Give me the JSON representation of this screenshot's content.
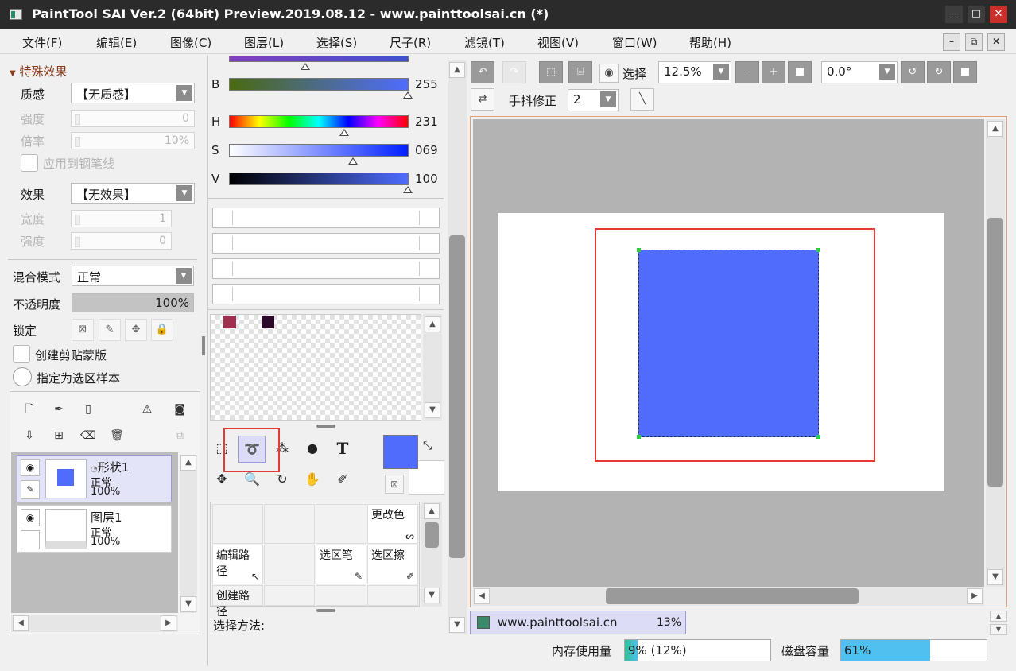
{
  "window": {
    "title": "PaintTool SAI Ver.2 (64bit) Preview.2019.08.12 - www.painttoolsai.cn (*)",
    "min": "–",
    "max": "□",
    "close": "✕"
  },
  "menu": [
    "文件(F)",
    "编辑(E)",
    "图像(C)",
    "图层(L)",
    "选择(S)",
    "尺子(R)",
    "滤镜(T)",
    "视图(V)",
    "窗口(W)",
    "帮助(H)"
  ],
  "mdi": {
    "min": "–",
    "restore": "⧉",
    "close": "✕"
  },
  "effects": {
    "header": "特殊效果",
    "texture_label": "质感",
    "texture_value": "【无质感】",
    "strength_label": "强度",
    "strength_value": "0",
    "scale_label": "倍率",
    "scale_value": "10%",
    "apply_pen_label": "应用到钢笔线",
    "effect_label": "效果",
    "effect_value": "【无效果】",
    "width_label": "宽度",
    "width_value": "1",
    "strength2_label": "强度",
    "strength2_value": "0"
  },
  "layer_props": {
    "blend_label": "混合模式",
    "blend_value": "正常",
    "opacity_label": "不透明度",
    "opacity_value": "100%",
    "opacity_fraction": 1.0,
    "lock_label": "锁定",
    "clip_label": "创建剪贴蒙版",
    "selection_sample_label": "指定为选区样本"
  },
  "layers": [
    {
      "name": "形状1",
      "mode": "正常",
      "opacity": "100%",
      "selected": true,
      "thumb_color": "#4f6cfd"
    },
    {
      "name": "图层1",
      "mode": "正常",
      "opacity": "100%",
      "selected": false
    }
  ],
  "color": {
    "B_label": "B",
    "B_value": "255",
    "H_label": "H",
    "H_value": "231",
    "S_label": "S",
    "S_value": "069",
    "V_label": "V",
    "V_value": "100",
    "primary": "#4f6cfd",
    "swatches": [
      "#a0304f",
      "#2a0a28"
    ]
  },
  "tools": {
    "text_tool": "T",
    "grid": {
      "change_color": "更改色",
      "edit_path": "编辑路径",
      "select_pen": "选区笔",
      "select_eraser": "选区擦",
      "create_path": "创建路径"
    },
    "selection_method_label": "选择方法:"
  },
  "toolbar": {
    "selection_label": "选择",
    "zoom_value": "12.5%",
    "rotation_value": "0.0°",
    "stabilizer_label": "手抖修正",
    "stabilizer_value": "2"
  },
  "canvas": {
    "shape_color": "#4f6cfd",
    "highlight_color": "#e53935"
  },
  "doc_tab": {
    "name": "www.painttoolsai.cn",
    "zoom": "13%"
  },
  "status": {
    "memory_label": "内存使用量",
    "memory_value": "9% (12%)",
    "memory_fraction": 0.09,
    "disk_label": "磁盘容量",
    "disk_value": "61%",
    "disk_fraction": 0.61
  }
}
